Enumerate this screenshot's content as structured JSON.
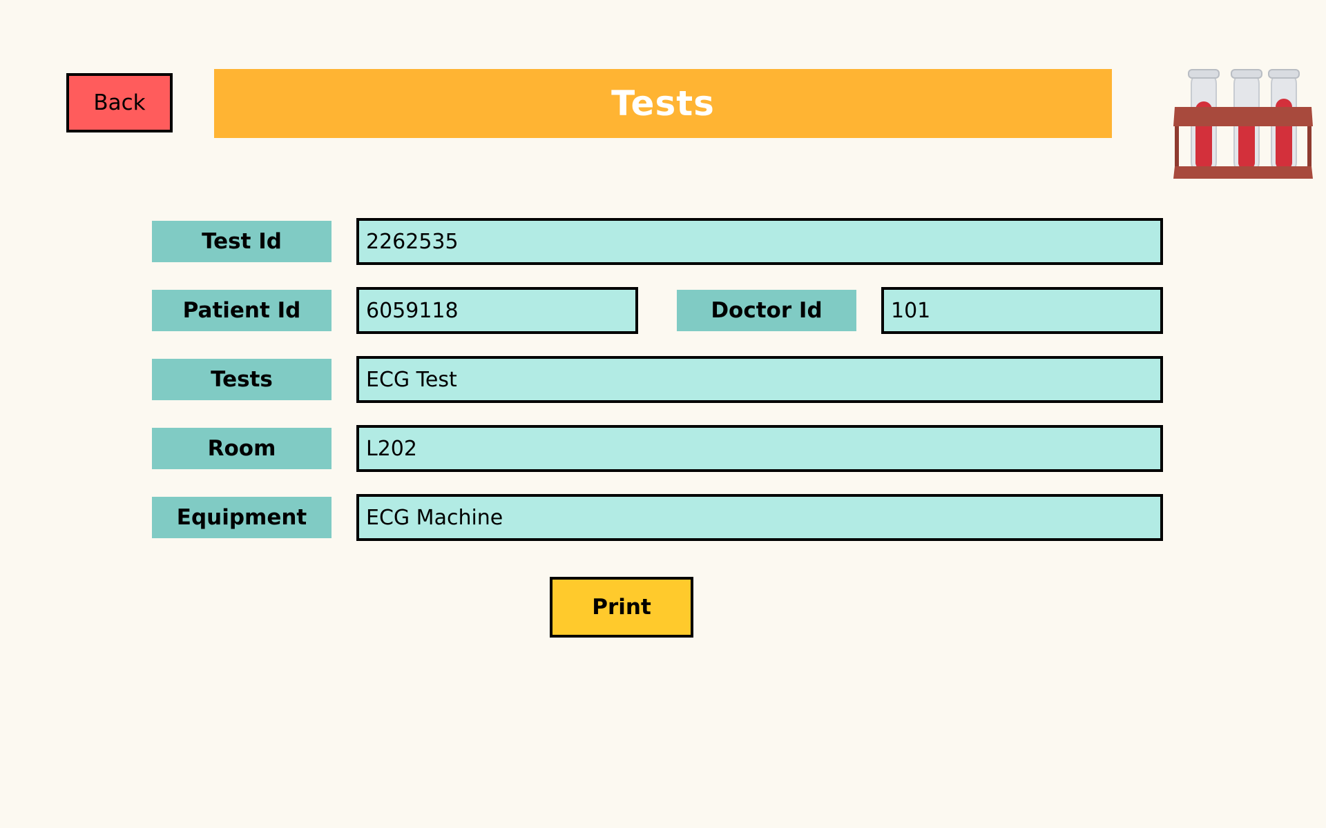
{
  "header": {
    "back_label": "Back",
    "title": "Tests"
  },
  "form": {
    "test_id": {
      "label": "Test Id",
      "value": "2262535"
    },
    "patient_id": {
      "label": "Patient Id",
      "value": "6059118"
    },
    "doctor_id": {
      "label": "Doctor Id",
      "value": "101"
    },
    "tests": {
      "label": "Tests",
      "value": "ECG Test"
    },
    "room": {
      "label": "Room",
      "value": "L202"
    },
    "equipment": {
      "label": "Equipment",
      "value": "ECG Machine"
    }
  },
  "actions": {
    "print_label": "Print"
  },
  "icons": {
    "header_image": "test-tubes-rack-icon"
  },
  "colors": {
    "background": "#fcf9f1",
    "back_button": "#ff5c5c",
    "title_bar": "#ffb433",
    "label_bg": "#80cbc4",
    "field_bg": "#b2ebe4",
    "print_button": "#ffca2c"
  }
}
